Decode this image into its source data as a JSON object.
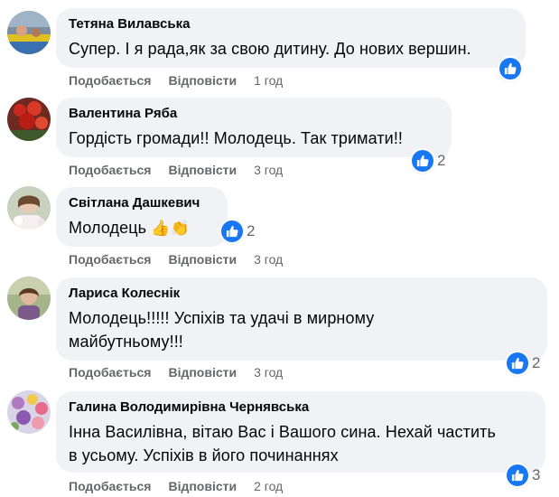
{
  "comments": [
    {
      "author": "Тетяна Вилавська",
      "text": "Супер. І я рада,як за свою дитину. До нових вершин.",
      "like_label": "Подобається",
      "reply_label": "Відповісти",
      "time": "1 год",
      "reactions_count": ""
    },
    {
      "author": "Валентина Ряба",
      "text": "Гордість громади!! Молодець. Так тримати!!",
      "like_label": "Подобається",
      "reply_label": "Відповісти",
      "time": "3 год",
      "reactions_count": "2"
    },
    {
      "author": "Світлана Дашкевич",
      "text": "Молодець",
      "emojis": "👍👏",
      "like_label": "Подобається",
      "reply_label": "Відповісти",
      "time": "3 год",
      "reactions_count": "2"
    },
    {
      "author": "Лариса Колеснік",
      "text_line1": "Молодець!!!!! Успіхів та удачі в мирному",
      "text_line2": "майбутньому!!!",
      "like_label": "Подобається",
      "reply_label": "Відповісти",
      "time": "3 год",
      "reactions_count": "2"
    },
    {
      "author": "Галина Володимирівна Чернявська",
      "text_line1": "Інна Василівна, вітаю Вас і Вашого сина. Нехай частить",
      "text_line2": "в усьому. Успіхів в його починаннях",
      "like_label": "Подобається",
      "reply_label": "Відповісти",
      "time": "2 год",
      "reactions_count": "3"
    }
  ],
  "colors": {
    "bubble": "#f0f2f5",
    "meta_text": "#65676b",
    "like_blue": "#1877f2"
  },
  "icons": {
    "reaction": "like-thumb-icon"
  }
}
